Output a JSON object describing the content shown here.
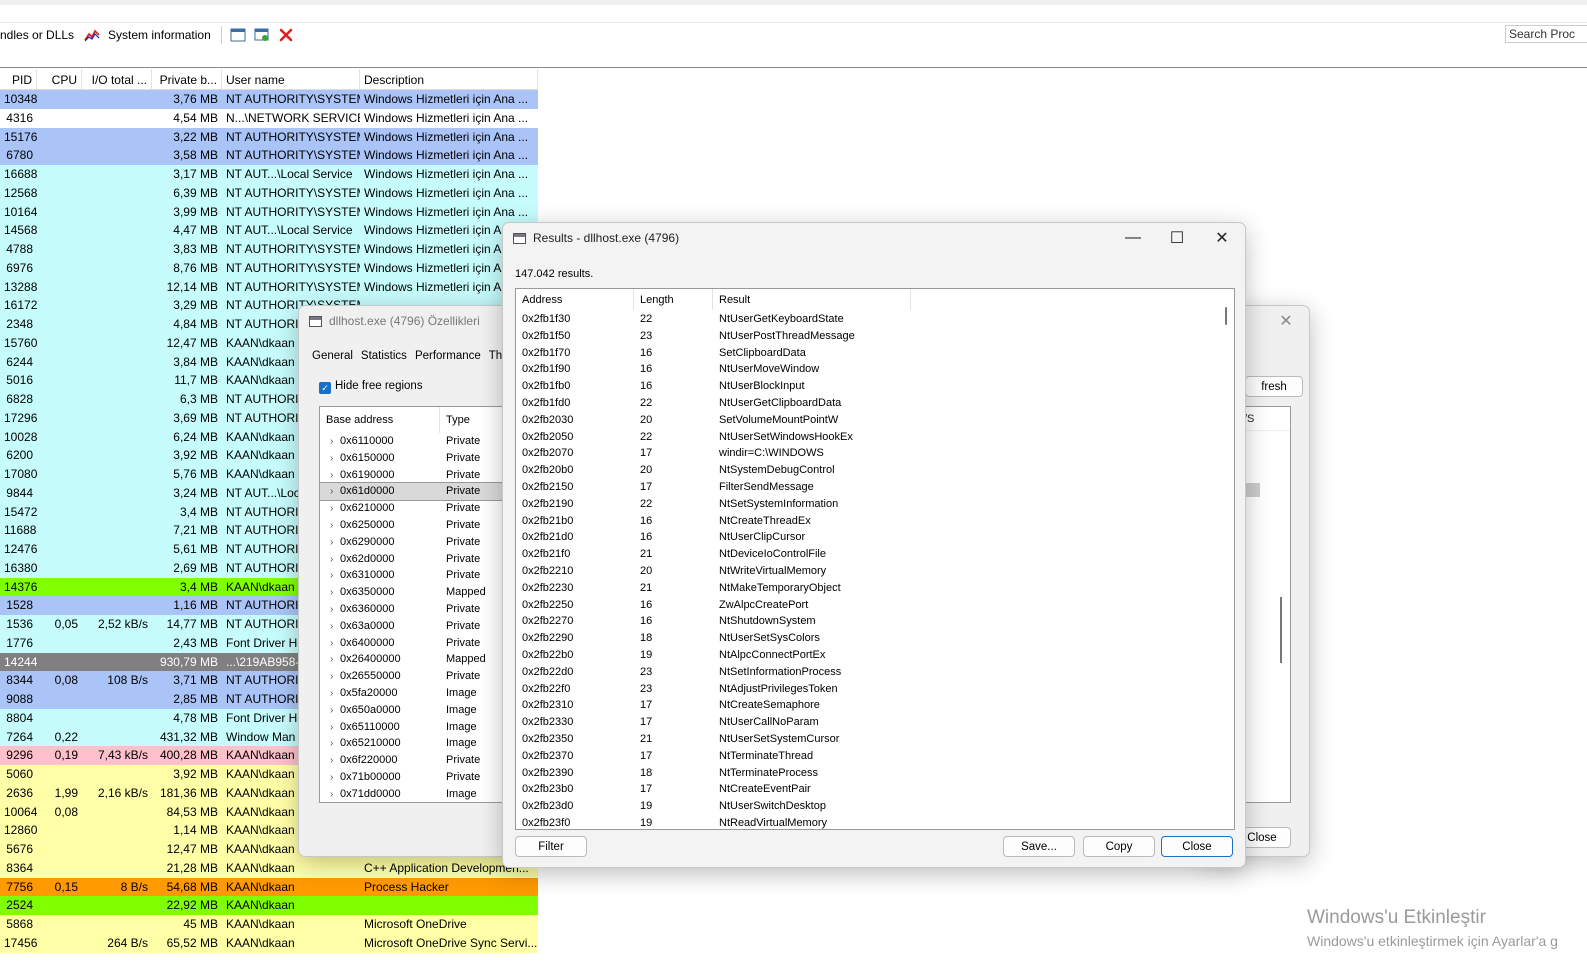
{
  "toolbar": {
    "handles_label": "ndles or DLLs",
    "sysinfo_label": "System information",
    "search_placeholder": "Search Proc"
  },
  "process_grid": {
    "columns": [
      "PID",
      "CPU",
      "I/O total ...",
      "Private b...",
      "User name",
      "Description"
    ],
    "rows": [
      {
        "pid": "10348",
        "cpu": "",
        "io": "",
        "priv": "3,76 MB",
        "user": "NT AUTHORITY\\SYSTEM",
        "desc": "Windows Hizmetleri için Ana ...",
        "bg": "#aac4f7"
      },
      {
        "pid": "4316",
        "cpu": "",
        "io": "",
        "priv": "4,54 MB",
        "user": "N...\\NETWORK SERVICE",
        "desc": "Windows Hizmetleri için Ana ...",
        "bg": "#ffffff"
      },
      {
        "pid": "15176",
        "cpu": "",
        "io": "",
        "priv": "3,22 MB",
        "user": "NT AUTHORITY\\SYSTEM",
        "desc": "Windows Hizmetleri için Ana ...",
        "bg": "#aac4f7"
      },
      {
        "pid": "6780",
        "cpu": "",
        "io": "",
        "priv": "3,58 MB",
        "user": "NT AUTHORITY\\SYSTEM",
        "desc": "Windows Hizmetleri için Ana ...",
        "bg": "#aac4f7"
      },
      {
        "pid": "16688",
        "cpu": "",
        "io": "",
        "priv": "3,17 MB",
        "user": "NT AUT...\\Local Service",
        "desc": "Windows Hizmetleri için Ana ...",
        "bg": "#c6fcfc"
      },
      {
        "pid": "12568",
        "cpu": "",
        "io": "",
        "priv": "6,39 MB",
        "user": "NT AUTHORITY\\SYSTEM",
        "desc": "Windows Hizmetleri için Ana ...",
        "bg": "#c6fcfc"
      },
      {
        "pid": "10164",
        "cpu": "",
        "io": "",
        "priv": "3,99 MB",
        "user": "NT AUTHORITY\\SYSTEM",
        "desc": "Windows Hizmetleri için Ana ...",
        "bg": "#c6fcfc"
      },
      {
        "pid": "14568",
        "cpu": "",
        "io": "",
        "priv": "4,47 MB",
        "user": "NT AUT...\\Local Service",
        "desc": "Windows Hizmetleri için Ana ...",
        "bg": "#c6fcfc"
      },
      {
        "pid": "4788",
        "cpu": "",
        "io": "",
        "priv": "3,83 MB",
        "user": "NT AUTHORITY\\SYSTEM",
        "desc": "Windows Hizmetleri için A",
        "bg": "#c6fcfc"
      },
      {
        "pid": "6976",
        "cpu": "",
        "io": "",
        "priv": "8,76 MB",
        "user": "NT AUTHORITY\\SYSTEM",
        "desc": "Windows Hizmetleri için A",
        "bg": "#c6fcfc"
      },
      {
        "pid": "13288",
        "cpu": "",
        "io": "",
        "priv": "12,14 MB",
        "user": "NT AUTHORITY\\SYSTEM",
        "desc": "Windows Hizmetleri için A",
        "bg": "#c6fcfc"
      },
      {
        "pid": "16172",
        "cpu": "",
        "io": "",
        "priv": "3,29 MB",
        "user": "NT AUTHORITY\\SYSTEM",
        "desc": "",
        "bg": "#c6fcfc"
      },
      {
        "pid": "2348",
        "cpu": "",
        "io": "",
        "priv": "4,84 MB",
        "user": "NT AUTHORITY",
        "desc": "",
        "bg": "#c6fcfc"
      },
      {
        "pid": "15760",
        "cpu": "",
        "io": "",
        "priv": "12,47 MB",
        "user": "KAAN\\dkaan",
        "desc": "",
        "bg": "#c6fcfc"
      },
      {
        "pid": "6244",
        "cpu": "",
        "io": "",
        "priv": "3,84 MB",
        "user": "KAAN\\dkaan",
        "desc": "",
        "bg": "#c6fcfc"
      },
      {
        "pid": "5016",
        "cpu": "",
        "io": "",
        "priv": "11,7 MB",
        "user": "KAAN\\dkaan",
        "desc": "",
        "bg": "#c6fcfc"
      },
      {
        "pid": "6828",
        "cpu": "",
        "io": "",
        "priv": "6,3 MB",
        "user": "NT AUTHORITY",
        "desc": "",
        "bg": "#c6fcfc"
      },
      {
        "pid": "17296",
        "cpu": "",
        "io": "",
        "priv": "3,69 MB",
        "user": "NT AUTHORITY",
        "desc": "",
        "bg": "#c6fcfc"
      },
      {
        "pid": "10028",
        "cpu": "",
        "io": "",
        "priv": "6,24 MB",
        "user": "KAAN\\dkaan",
        "desc": "",
        "bg": "#c6fcfc"
      },
      {
        "pid": "6200",
        "cpu": "",
        "io": "",
        "priv": "3,92 MB",
        "user": "KAAN\\dkaan",
        "desc": "",
        "bg": "#c6fcfc"
      },
      {
        "pid": "17080",
        "cpu": "",
        "io": "",
        "priv": "5,76 MB",
        "user": "KAAN\\dkaan",
        "desc": "",
        "bg": "#c6fcfc"
      },
      {
        "pid": "9844",
        "cpu": "",
        "io": "",
        "priv": "3,24 MB",
        "user": "NT AUT...\\Loc",
        "desc": "",
        "bg": "#c6fcfc"
      },
      {
        "pid": "15472",
        "cpu": "",
        "io": "",
        "priv": "3,4 MB",
        "user": "NT AUTHORITY",
        "desc": "",
        "bg": "#c6fcfc"
      },
      {
        "pid": "11688",
        "cpu": "",
        "io": "",
        "priv": "7,21 MB",
        "user": "NT AUTHORITY",
        "desc": "",
        "bg": "#c6fcfc"
      },
      {
        "pid": "12476",
        "cpu": "",
        "io": "",
        "priv": "5,61 MB",
        "user": "NT AUTHORITY",
        "desc": "",
        "bg": "#c6fcfc"
      },
      {
        "pid": "16380",
        "cpu": "",
        "io": "",
        "priv": "2,69 MB",
        "user": "NT AUTHORITY",
        "desc": "",
        "bg": "#c6fcfc"
      },
      {
        "pid": "14376",
        "cpu": "",
        "io": "",
        "priv": "3,4 MB",
        "user": "KAAN\\dkaan",
        "desc": "",
        "bg": "#80ff00"
      },
      {
        "pid": "1528",
        "cpu": "",
        "io": "",
        "priv": "1,16 MB",
        "user": "NT AUTHORITY",
        "desc": "",
        "bg": "#aac4f7"
      },
      {
        "pid": "1536",
        "cpu": "0,05",
        "io": "2,52 kB/s",
        "priv": "14,77 MB",
        "user": "NT AUTHORITY",
        "desc": "",
        "bg": "#c6fcfc"
      },
      {
        "pid": "1776",
        "cpu": "",
        "io": "",
        "priv": "2,43 MB",
        "user": "Font Driver Ho",
        "desc": "",
        "bg": "#c6fcfc"
      },
      {
        "pid": "14244",
        "cpu": "",
        "io": "",
        "priv": "930,79 MB",
        "user": "...\\219AB958-",
        "desc": "",
        "bg": "#808080"
      },
      {
        "pid": "8344",
        "cpu": "0,08",
        "io": "108 B/s",
        "priv": "3,71 MB",
        "user": "NT AUTHORITY",
        "desc": "",
        "bg": "#aac4f7"
      },
      {
        "pid": "9088",
        "cpu": "",
        "io": "",
        "priv": "2,85 MB",
        "user": "NT AUTHORITY",
        "desc": "",
        "bg": "#aac4f7"
      },
      {
        "pid": "8804",
        "cpu": "",
        "io": "",
        "priv": "4,78 MB",
        "user": "Font Driver Ho",
        "desc": "",
        "bg": "#c6fcfc"
      },
      {
        "pid": "7264",
        "cpu": "0,22",
        "io": "",
        "priv": "431,32 MB",
        "user": "Window Man",
        "desc": "",
        "bg": "#c6fcfc"
      },
      {
        "pid": "9296",
        "cpu": "0,19",
        "io": "7,43 kB/s",
        "priv": "400,28 MB",
        "user": "KAAN\\dkaan",
        "desc": "",
        "bg": "#ffc0cb"
      },
      {
        "pid": "5060",
        "cpu": "",
        "io": "",
        "priv": "3,92 MB",
        "user": "KAAN\\dkaan",
        "desc": "",
        "bg": "#ffffa8"
      },
      {
        "pid": "2636",
        "cpu": "1,99",
        "io": "2,16 kB/s",
        "priv": "181,36 MB",
        "user": "KAAN\\dkaan",
        "desc": "",
        "bg": "#ffffa8"
      },
      {
        "pid": "10064",
        "cpu": "0,08",
        "io": "",
        "priv": "84,53 MB",
        "user": "KAAN\\dkaan",
        "desc": "",
        "bg": "#ffffa8"
      },
      {
        "pid": "12860",
        "cpu": "",
        "io": "",
        "priv": "1,14 MB",
        "user": "KAAN\\dkaan",
        "desc": "",
        "bg": "#ffffa8"
      },
      {
        "pid": "5676",
        "cpu": "",
        "io": "",
        "priv": "12,47 MB",
        "user": "KAAN\\dkaan",
        "desc": "",
        "bg": "#ffffa8"
      },
      {
        "pid": "8364",
        "cpu": "",
        "io": "",
        "priv": "21,28 MB",
        "user": "KAAN\\dkaan",
        "desc": "C++ Application Developmen...",
        "bg": "#ffffa8"
      },
      {
        "pid": "7756",
        "cpu": "0,15",
        "io": "8 B/s",
        "priv": "54,68 MB",
        "user": "KAAN\\dkaan",
        "desc": "Process Hacker",
        "bg": "#ff9900"
      },
      {
        "pid": "2524",
        "cpu": "",
        "io": "",
        "priv": "22,92 MB",
        "user": "KAAN\\dkaan",
        "desc": "",
        "bg": "#80ff00"
      },
      {
        "pid": "5868",
        "cpu": "",
        "io": "",
        "priv": "45 MB",
        "user": "KAAN\\dkaan",
        "desc": "Microsoft OneDrive",
        "bg": "#ffffa8"
      },
      {
        "pid": "17456",
        "cpu": "",
        "io": "264 B/s",
        "priv": "65,52 MB",
        "user": "KAAN\\dkaan",
        "desc": "Microsoft OneDrive Sync Servi...",
        "bg": "#ffffa8"
      }
    ]
  },
  "background_window": {
    "refresh_label": "fresh",
    "col_fragment": "/S",
    "close_label": "Close"
  },
  "props_window": {
    "title": "dllhost.exe (4796) Özellikleri",
    "tabs": [
      "General",
      "Statistics",
      "Performance",
      "Thr"
    ],
    "hide_free_label": "Hide free regions",
    "columns": [
      "Base address",
      "Type"
    ],
    "rows": [
      {
        "addr": "0x6110000",
        "type": "Private"
      },
      {
        "addr": "0x6150000",
        "type": "Private"
      },
      {
        "addr": "0x6190000",
        "type": "Private"
      },
      {
        "addr": "0x61d0000",
        "type": "Private",
        "selected": true
      },
      {
        "addr": "0x6210000",
        "type": "Private"
      },
      {
        "addr": "0x6250000",
        "type": "Private"
      },
      {
        "addr": "0x6290000",
        "type": "Private"
      },
      {
        "addr": "0x62d0000",
        "type": "Private"
      },
      {
        "addr": "0x6310000",
        "type": "Private"
      },
      {
        "addr": "0x6350000",
        "type": "Mapped"
      },
      {
        "addr": "0x6360000",
        "type": "Private"
      },
      {
        "addr": "0x63a0000",
        "type": "Private"
      },
      {
        "addr": "0x6400000",
        "type": "Private"
      },
      {
        "addr": "0x26400000",
        "type": "Mapped"
      },
      {
        "addr": "0x26550000",
        "type": "Private"
      },
      {
        "addr": "0x5fa20000",
        "type": "Image"
      },
      {
        "addr": "0x650a0000",
        "type": "Image"
      },
      {
        "addr": "0x65110000",
        "type": "Image"
      },
      {
        "addr": "0x65210000",
        "type": "Image"
      },
      {
        "addr": "0x6f220000",
        "type": "Private"
      },
      {
        "addr": "0x71b00000",
        "type": "Private"
      },
      {
        "addr": "0x71dd0000",
        "type": "Image"
      }
    ]
  },
  "results_window": {
    "title": "Results - dllhost.exe (4796)",
    "count_text": "147.042 results.",
    "columns": [
      "Address",
      "Length",
      "Result"
    ],
    "rows": [
      {
        "addr": "0x2fb1f30",
        "len": "22",
        "res": "NtUserGetKeyboardState"
      },
      {
        "addr": "0x2fb1f50",
        "len": "23",
        "res": "NtUserPostThreadMessage"
      },
      {
        "addr": "0x2fb1f70",
        "len": "16",
        "res": "SetClipboardData"
      },
      {
        "addr": "0x2fb1f90",
        "len": "16",
        "res": "NtUserMoveWindow"
      },
      {
        "addr": "0x2fb1fb0",
        "len": "16",
        "res": "NtUserBlockInput"
      },
      {
        "addr": "0x2fb1fd0",
        "len": "22",
        "res": "NtUserGetClipboardData"
      },
      {
        "addr": "0x2fb2030",
        "len": "20",
        "res": "SetVolumeMountPointW"
      },
      {
        "addr": "0x2fb2050",
        "len": "22",
        "res": "NtUserSetWindowsHookEx"
      },
      {
        "addr": "0x2fb2070",
        "len": "17",
        "res": "windir=C:\\WINDOWS"
      },
      {
        "addr": "0x2fb20b0",
        "len": "20",
        "res": "NtSystemDebugControl"
      },
      {
        "addr": "0x2fb2150",
        "len": "17",
        "res": "FilterSendMessage"
      },
      {
        "addr": "0x2fb2190",
        "len": "22",
        "res": "NtSetSystemInformation"
      },
      {
        "addr": "0x2fb21b0",
        "len": "16",
        "res": "NtCreateThreadEx"
      },
      {
        "addr": "0x2fb21d0",
        "len": "16",
        "res": "NtUserClipCursor"
      },
      {
        "addr": "0x2fb21f0",
        "len": "21",
        "res": "NtDeviceIoControlFile"
      },
      {
        "addr": "0x2fb2210",
        "len": "20",
        "res": "NtWriteVirtualMemory"
      },
      {
        "addr": "0x2fb2230",
        "len": "21",
        "res": "NtMakeTemporaryObject"
      },
      {
        "addr": "0x2fb2250",
        "len": "16",
        "res": "ZwAlpcCreatePort"
      },
      {
        "addr": "0x2fb2270",
        "len": "16",
        "res": "NtShutdownSystem"
      },
      {
        "addr": "0x2fb2290",
        "len": "18",
        "res": "NtUserSetSysColors"
      },
      {
        "addr": "0x2fb22b0",
        "len": "19",
        "res": "NtAlpcConnectPortEx"
      },
      {
        "addr": "0x2fb22d0",
        "len": "23",
        "res": "NtSetInformationProcess"
      },
      {
        "addr": "0x2fb22f0",
        "len": "23",
        "res": "NtAdjustPrivilegesToken"
      },
      {
        "addr": "0x2fb2310",
        "len": "17",
        "res": "NtCreateSemaphore"
      },
      {
        "addr": "0x2fb2330",
        "len": "17",
        "res": "NtUserCallNoParam"
      },
      {
        "addr": "0x2fb2350",
        "len": "21",
        "res": "NtUserSetSystemCursor"
      },
      {
        "addr": "0x2fb2370",
        "len": "17",
        "res": "NtTerminateThread"
      },
      {
        "addr": "0x2fb2390",
        "len": "18",
        "res": "NtTerminateProcess"
      },
      {
        "addr": "0x2fb23b0",
        "len": "17",
        "res": "NtCreateEventPair"
      },
      {
        "addr": "0x2fb23d0",
        "len": "19",
        "res": "NtUserSwitchDesktop"
      },
      {
        "addr": "0x2fb23f0",
        "len": "19",
        "res": "NtReadVirtualMemory"
      }
    ],
    "filter_label": "Filter",
    "save_label": "Save...",
    "copy_label": "Copy",
    "close_label": "Close"
  },
  "watermark": {
    "line1": "Windows'u Etkinleştir",
    "line2": "Windows'u etkinleştirmek için Ayarlar'a g"
  }
}
